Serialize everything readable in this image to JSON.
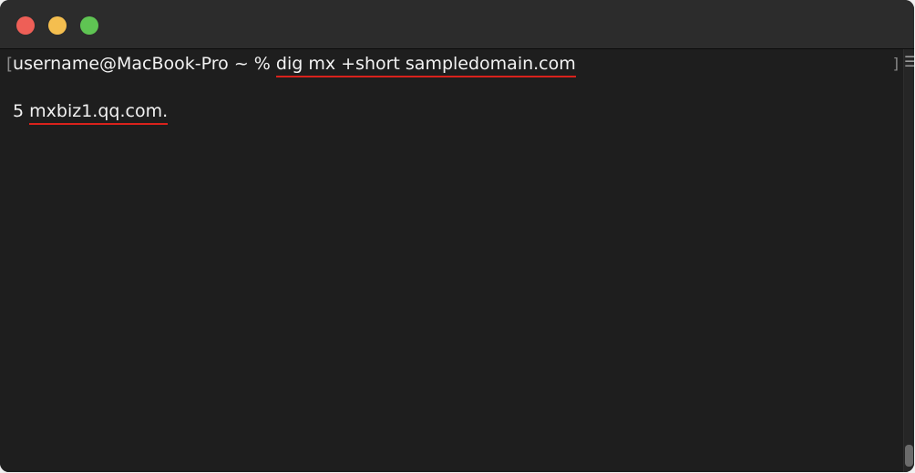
{
  "window": {
    "buttons": {
      "close": "close",
      "minimize": "minimize",
      "zoom": "zoom"
    },
    "colors": {
      "close": "#ee5f57",
      "minimize": "#f4be4f",
      "zoom": "#5fc453",
      "highlight_underline": "#d9221c"
    }
  },
  "terminal": {
    "left_bracket": "[",
    "prompt": "username@MacBook-Pro ~ % ",
    "command": "dig mx +short sampledomain.com",
    "output_priority": "5 ",
    "output_host": "mxbiz1.qq.com.",
    "right_bracket": "]",
    "menu_icon": "list-icon"
  }
}
